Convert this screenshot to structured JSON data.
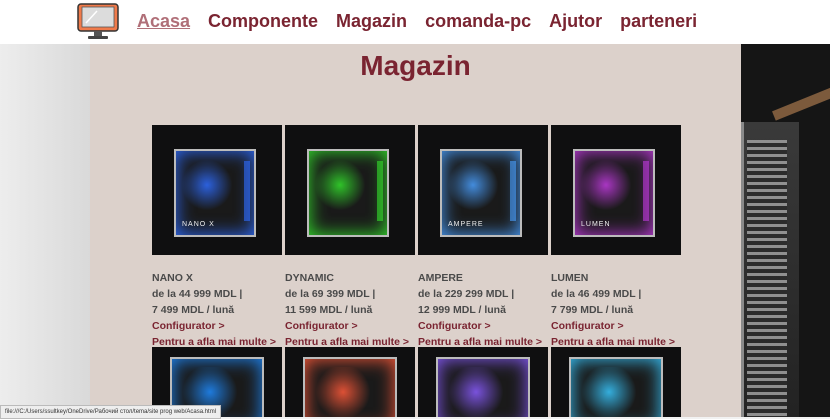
{
  "nav": {
    "items": [
      "Acasa",
      "Componente",
      "Magazin",
      "comanda-pc",
      "Ajutor",
      "parteneri"
    ],
    "active": "Acasa"
  },
  "page": {
    "title": "Magazin"
  },
  "products": [
    {
      "name": "NANO X",
      "price": "de la 44 999 MDL |",
      "monthly": "7 499 MDL / lună",
      "configurator": "Configurator >",
      "more": "Pentru a afla mai multe >",
      "glow": "#2f6dff",
      "badge": "NANO X"
    },
    {
      "name": "DYNAMIC",
      "price": "de la 69 399 MDL |",
      "monthly": "11 599 MDL / lună",
      "configurator": "Configurator >",
      "more": "Pentru a afla mai multe >",
      "glow": "#33e02c",
      "badge": ""
    },
    {
      "name": "AMPERE",
      "price": "de la 229 299 MDL |",
      "monthly": "12 999 MDL / lună",
      "configurator": "Configurator >",
      "more": "Pentru a afla mai multe >",
      "glow": "#4aa0ff",
      "badge": "AMPERE"
    },
    {
      "name": "LUMEN",
      "price": "de la 46 499 MDL |",
      "monthly": "7 799 MDL / lună",
      "configurator": "Configurator >",
      "more": "Pentru a afla mai multe >",
      "glow": "#c23be0",
      "badge": "LUMEN"
    }
  ],
  "second_row_glows": [
    "#1f8cff",
    "#ff5a3a",
    "#8a5cff",
    "#39c8ff"
  ],
  "status_bar": "file:///C:/Users/ssultkey/OneDrive/Рабочий стол/tema/site prog web/Acasa.html",
  "colors": {
    "accent": "#7a2431",
    "active_link": "#b06f78",
    "panel": "#dcd1cb"
  }
}
